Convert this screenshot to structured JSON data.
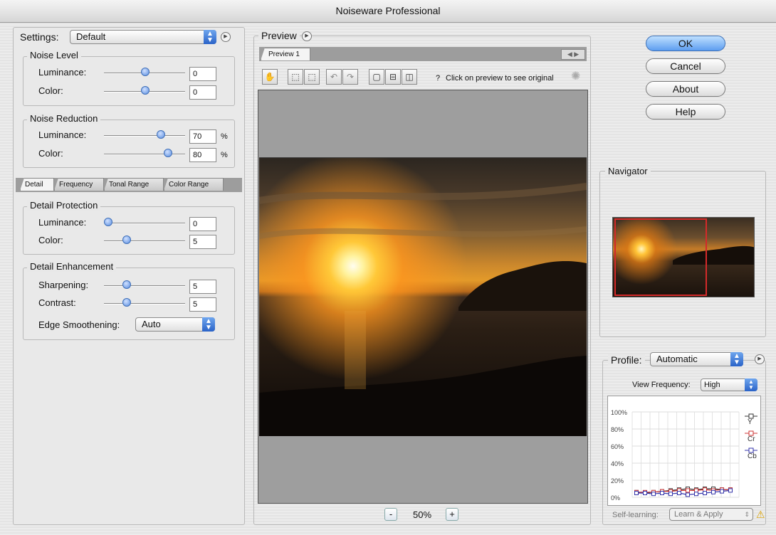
{
  "window": {
    "title": "Noiseware Professional"
  },
  "settings": {
    "label": "Settings:",
    "value": "Default"
  },
  "noise_level": {
    "title": "Noise Level",
    "luminance": {
      "label": "Luminance:",
      "value": "0"
    },
    "color": {
      "label": "Color:",
      "value": "0"
    }
  },
  "noise_reduction": {
    "title": "Noise Reduction",
    "luminance": {
      "label": "Luminance:",
      "value": "70",
      "unit": "%"
    },
    "color": {
      "label": "Color:",
      "value": "80",
      "unit": "%"
    }
  },
  "tabs": [
    "Detail",
    "Frequency",
    "Tonal Range",
    "Color Range"
  ],
  "detail_protection": {
    "title": "Detail Protection",
    "luminance": {
      "label": "Luminance:",
      "value": "0"
    },
    "color": {
      "label": "Color:",
      "value": "5"
    }
  },
  "detail_enhancement": {
    "title": "Detail Enhancement",
    "sharpening": {
      "label": "Sharpening:",
      "value": "5"
    },
    "contrast": {
      "label": "Contrast:",
      "value": "5"
    },
    "edge_smoothening": {
      "label": "Edge Smoothening:",
      "value": "Auto"
    }
  },
  "preview": {
    "title": "Preview",
    "tab": "Preview 1",
    "hint_icon": "?",
    "hint": "Click on preview to see original",
    "zoom": "50%",
    "zoom_out": "-",
    "zoom_in": "+"
  },
  "buttons": {
    "ok": "OK",
    "cancel": "Cancel",
    "about": "About",
    "help": "Help"
  },
  "navigator": {
    "title": "Navigator"
  },
  "profile": {
    "label": "Profile:",
    "value": "Automatic",
    "view_frequency_label": "View Frequency:",
    "view_frequency_value": "High",
    "self_learning_label": "Self-learning:",
    "self_learning_value": "Learn & Apply"
  },
  "graph": {
    "y_ticks": [
      "100%",
      "80%",
      "60%",
      "40%",
      "20%",
      "0%"
    ],
    "legend": [
      {
        "name": "Y",
        "color": "#333333"
      },
      {
        "name": "Cr",
        "color": "#cc3333"
      },
      {
        "name": "Cb",
        "color": "#3333aa"
      }
    ]
  },
  "colors": {
    "accent": "#4a86e0",
    "nav_frame": "#d42a2a"
  }
}
